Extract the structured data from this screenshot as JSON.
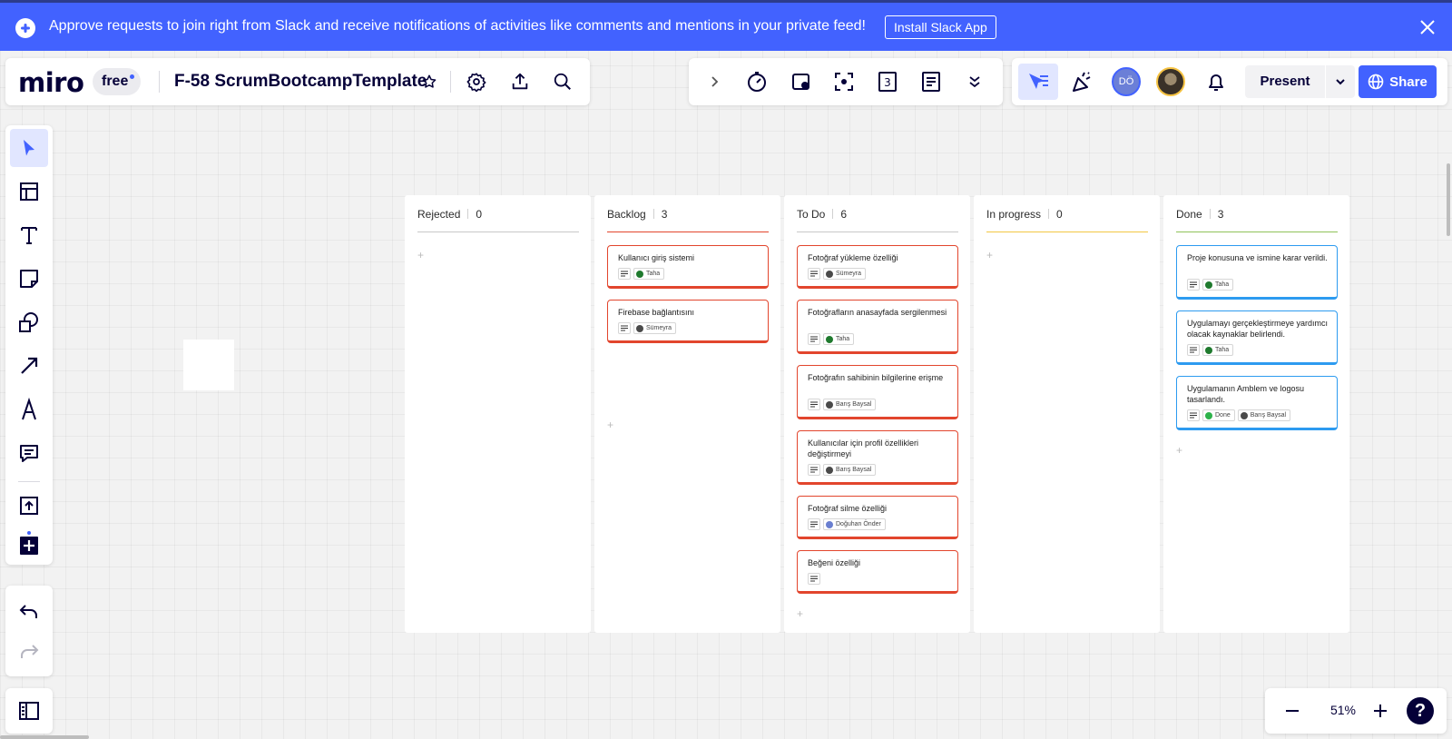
{
  "banner": {
    "message": "Approve requests to join right from Slack and receive notifications of activities like comments and mentions in your private feed!",
    "install_label": "Install Slack App",
    "icon": "slack-icon",
    "close_icon": "close-icon",
    "color": "#4262ff"
  },
  "header": {
    "logo": "miro",
    "plan": "free",
    "board_title": "F-58 ScrumBootcampTemplate",
    "icons": [
      "star-icon",
      "settings-icon",
      "upload-icon",
      "search-icon"
    ]
  },
  "center_toolbar": {
    "icons": [
      "chevron-right-icon",
      "timer-icon",
      "voting-icon",
      "frame-focus-icon",
      "calendar-icon",
      "notes-icon",
      "double-chevron-down-icon"
    ]
  },
  "right_toolbar": {
    "avatar_initials": "DÖ",
    "present_label": "Present",
    "share_label": "Share",
    "icons": [
      "collaboration-cursor-icon",
      "celebrate-icon",
      "bell-icon",
      "chevron-down-icon",
      "globe-icon"
    ]
  },
  "left_toolbar": {
    "tools": [
      "select-tool-icon",
      "templates-icon",
      "text-tool-icon",
      "sticky-note-icon",
      "shapes-icon",
      "arrow-tool-icon",
      "pen-tool-icon",
      "comment-icon",
      "upload-tool-icon",
      "add-more-icon"
    ],
    "undo_icon": "undo-icon",
    "redo_icon": "redo-icon",
    "board_panel_icon": "sidebar-panel-icon"
  },
  "zoom": {
    "value": "51%",
    "help": "?"
  },
  "kanban": {
    "columns": [
      {
        "name": "Rejected",
        "count": "0",
        "line_color": "#c8c8c8",
        "cards": []
      },
      {
        "name": "Backlog",
        "count": "3",
        "line_color": "#e2452d",
        "cards": [
          {
            "title": "Kullanıcı giriş sistemi",
            "assignee": "Taha",
            "color": "red"
          },
          {
            "title": "Firebase bağlantısını",
            "assignee": "Sümeyra",
            "color": "red"
          }
        ]
      },
      {
        "name": "To Do",
        "count": "6",
        "line_color": "#c8c8c8",
        "cards": [
          {
            "title": "Fotoğraf yükleme özelliği",
            "assignee": "Sümeyra",
            "color": "red"
          },
          {
            "title": "Fotoğrafların anasayfada sergilenmesi",
            "assignee": "Taha",
            "color": "red"
          },
          {
            "title": "Fotoğrafın sahibinin bilgilerine erişme",
            "assignee": "Barış Baysal",
            "color": "red"
          },
          {
            "title": "Kullanıcılar için profil özellikleri değiştirmeyi",
            "assignee": "Barış Baysal",
            "color": "red"
          },
          {
            "title": "Fotoğraf silme özelliği",
            "assignee": "Doğuhan Önder",
            "color": "red"
          },
          {
            "title": "Beğeni özelliği",
            "assignee": "",
            "color": "red"
          }
        ]
      },
      {
        "name": "In progress",
        "count": "0",
        "line_color": "#f2c744",
        "cards": []
      },
      {
        "name": "Done",
        "count": "3",
        "line_color": "#8fc25a",
        "cards": [
          {
            "title": "Proje konusuna ve ismine karar verildi.",
            "assignee": "Taha",
            "color": "blue"
          },
          {
            "title": "Uygulamayı gerçekleştirmeye yardımcı olacak kaynaklar belirlendi.",
            "assignee": "Taha",
            "color": "blue"
          },
          {
            "title": "Uygulamanın Amblem ve logosu tasarlandı.",
            "status": "Done",
            "assignee": "Barış Baysal",
            "color": "blue"
          }
        ]
      }
    ]
  }
}
